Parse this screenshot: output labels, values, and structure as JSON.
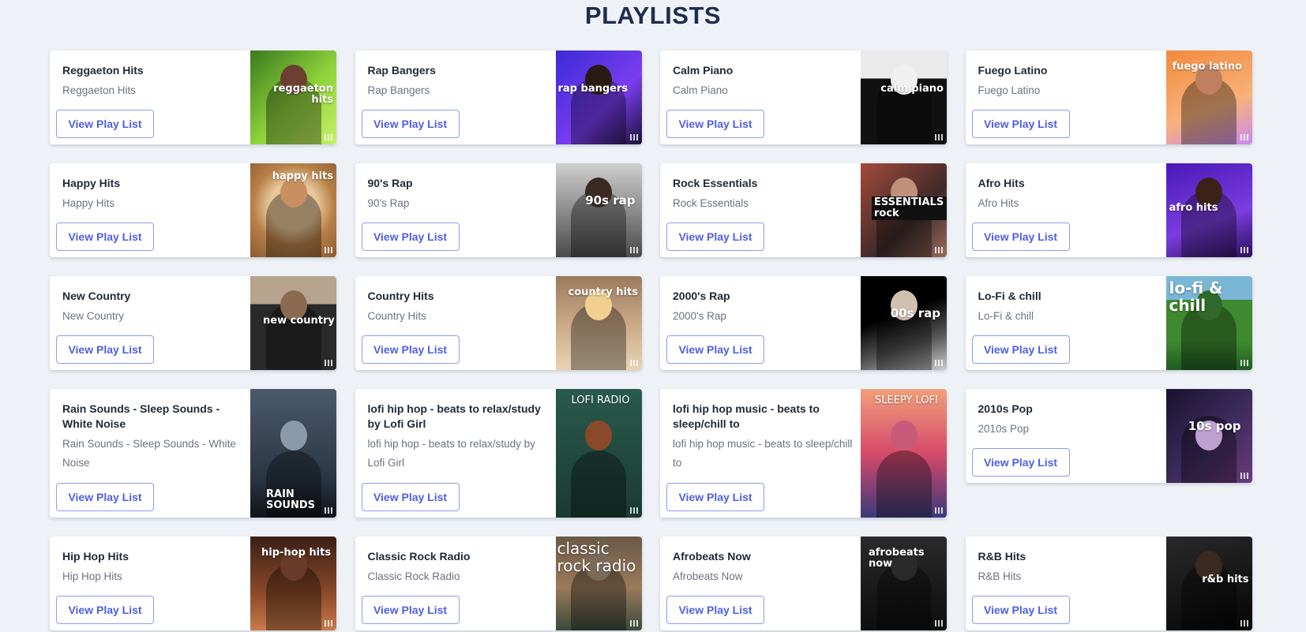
{
  "page": {
    "title": "PLAYLISTS"
  },
  "button_label": "View Play List",
  "playlists": [
    {
      "title": "Reggaeton Hits",
      "subtitle": "Reggaeton Hits",
      "cover_text": "reggaeton hits",
      "cover_bg": "#8fd33a"
    },
    {
      "title": "Rap Bangers",
      "subtitle": "Rap Bangers",
      "cover_text": "rap bangers",
      "cover_bg": "#5b3df0"
    },
    {
      "title": "Calm Piano",
      "subtitle": "Calm Piano",
      "cover_text": "calm piano",
      "cover_bg": "#1a1a1a"
    },
    {
      "title": "Fuego Latino",
      "subtitle": "Fuego Latino",
      "cover_text": "fuego latino",
      "cover_bg": "#f79a4c"
    },
    {
      "title": "Happy Hits",
      "subtitle": "Happy Hits",
      "cover_text": "happy hits",
      "cover_bg": "#c9a06c"
    },
    {
      "title": "90's Rap",
      "subtitle": "90's Rap",
      "cover_text": "90s rap",
      "cover_bg": "#6a6a6a"
    },
    {
      "title": "Rock Essentials",
      "subtitle": "Rock Essentials",
      "cover_text": "ESSENTIALS rock",
      "cover_bg": "#7a2e2e"
    },
    {
      "title": "Afro Hits",
      "subtitle": "Afro Hits",
      "cover_text": "afro hits",
      "cover_bg": "#6b2bd1"
    },
    {
      "title": "New Country",
      "subtitle": "New Country",
      "cover_text": "new country",
      "cover_bg": "#5a4332"
    },
    {
      "title": "Country Hits",
      "subtitle": "Country Hits",
      "cover_text": "country hits",
      "cover_bg": "#a98a6e"
    },
    {
      "title": "2000's Rap",
      "subtitle": "2000's Rap",
      "cover_text": "00s rap",
      "cover_bg": "#111111"
    },
    {
      "title": "Lo-Fi & chill",
      "subtitle": "Lo-Fi & chill",
      "cover_text": "lo-fi & chill",
      "cover_bg": "#4f8a3c"
    },
    {
      "title": "Rain Sounds - Sleep Sounds - White Noise",
      "subtitle": "Rain Sounds - Sleep Sounds - White Noise",
      "cover_text": "RAIN SOUNDS",
      "cover_bg": "#3a4a5c"
    },
    {
      "title": "lofi hip hop - beats to relax/study by Lofi Girl",
      "subtitle": "lofi hip hop - beats to relax/study by Lofi Girl",
      "cover_text": "LOFI RADIO",
      "cover_bg": "#1f4d43"
    },
    {
      "title": "lofi hip hop music - beats to sleep/chill to",
      "subtitle": "lofi hip hop music - beats to sleep/chill to",
      "cover_text": "SLEEPY LOFI",
      "cover_bg": "#d9546e"
    },
    {
      "title": "2010s Pop",
      "subtitle": "2010s Pop",
      "cover_text": "10s pop",
      "cover_bg": "#2b1f3a"
    },
    {
      "title": "Hip Hop Hits",
      "subtitle": "Hip Hop Hits",
      "cover_text": "hip-hop hits",
      "cover_bg": "#6b3a2a"
    },
    {
      "title": "Classic Rock Radio",
      "subtitle": "Classic Rock Radio",
      "cover_text": "classic rock radio",
      "cover_bg": "#8b6a48"
    },
    {
      "title": "Afrobeats Now",
      "subtitle": "Afrobeats Now",
      "cover_text": "afrobeats now",
      "cover_bg": "#1c1c1c"
    },
    {
      "title": "R&B Hits",
      "subtitle": "R&B Hits",
      "cover_text": "r&b hits",
      "cover_bg": "#111111"
    }
  ]
}
